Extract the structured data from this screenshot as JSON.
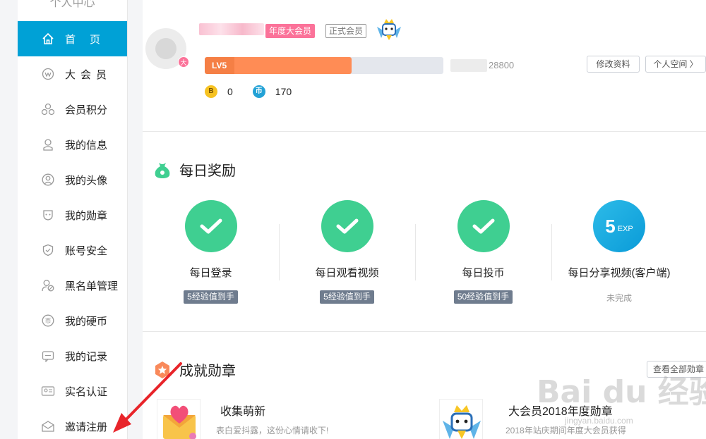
{
  "sidebar": {
    "header": "个人中心",
    "items": [
      {
        "label": "首页",
        "icon": "home-icon",
        "active": true
      },
      {
        "label": "大会员",
        "icon": "vip-icon"
      },
      {
        "label": "会员积分",
        "icon": "points-icon"
      },
      {
        "label": "我的信息",
        "icon": "user-info-icon"
      },
      {
        "label": "我的头像",
        "icon": "avatar-icon"
      },
      {
        "label": "我的勋章",
        "icon": "medal-icon"
      },
      {
        "label": "账号安全",
        "icon": "shield-icon"
      },
      {
        "label": "黑名单管理",
        "icon": "blacklist-icon"
      },
      {
        "label": "我的硬币",
        "icon": "coin-icon"
      },
      {
        "label": "我的记录",
        "icon": "record-icon"
      },
      {
        "label": "实名认证",
        "icon": "id-card-icon"
      },
      {
        "label": "邀请注册",
        "icon": "invite-icon"
      }
    ]
  },
  "profile": {
    "vip_tag": "年度大会员",
    "member_tag": "正式会员",
    "vip_avatar_mark": "大",
    "level": "LV5",
    "level_progress": 0.56,
    "exp_total": "28800",
    "edit_button": "修改资料",
    "space_button": "个人空间 〉",
    "b_coin_icon": "B",
    "b_coins": "0",
    "coin_icon": "币",
    "coins": "170"
  },
  "daily": {
    "title": "每日奖励",
    "tasks": [
      {
        "name": "每日登录",
        "reward": "5经验值到手",
        "done": true
      },
      {
        "name": "每日观看视频",
        "reward": "5经验值到手",
        "done": true
      },
      {
        "name": "每日投币",
        "reward": "50经验值到手",
        "done": true
      },
      {
        "name": "每日分享视频(客户端)",
        "reward": "未完成",
        "done": false,
        "exp_value": "5",
        "exp_unit": "EXP"
      }
    ]
  },
  "achievements": {
    "title": "成就勋章",
    "view_all": "查看全部勋章",
    "medals": [
      {
        "name": "收集萌新",
        "desc": "表白爱抖露，这份心情请收下!"
      },
      {
        "name": "大会员2018年度勋章",
        "desc": "2018年站庆期间年度大会员获得"
      }
    ]
  },
  "watermark": {
    "main": "Bai du 经验",
    "sub": "jingyan.baidu.com"
  },
  "colors": {
    "accent": "#00a1d6",
    "pink": "#fb7299",
    "orange": "#f57f45",
    "green": "#3fcf91"
  }
}
